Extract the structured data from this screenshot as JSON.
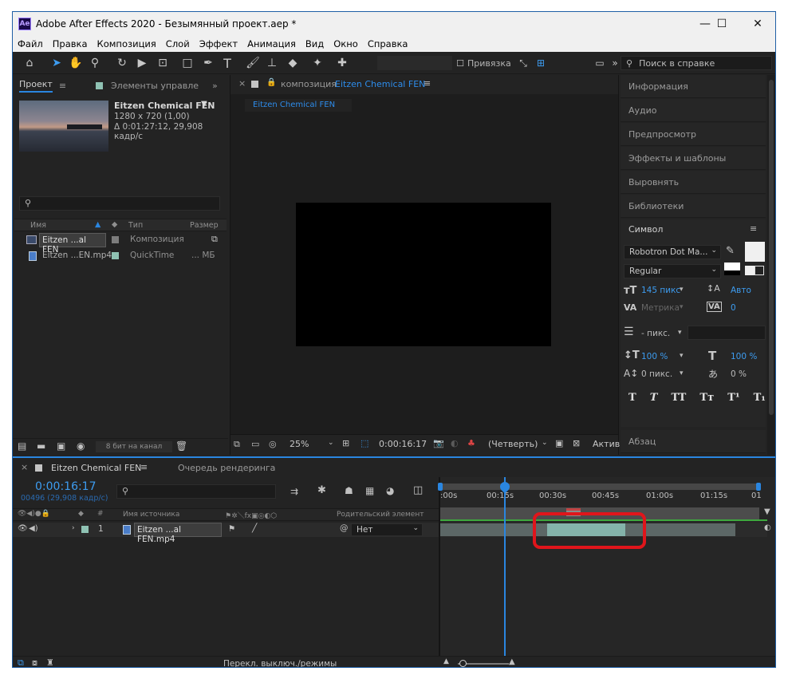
{
  "window": {
    "title": "Adobe After Effects 2020 - Безымянный проект.aep *",
    "app_icon": "Ae",
    "controls": [
      "—",
      "☐",
      "✕"
    ]
  },
  "menu": [
    "Файл",
    "Правка",
    "Композиция",
    "Слой",
    "Эффект",
    "Анимация",
    "Вид",
    "Окно",
    "Справка"
  ],
  "toolbar": {
    "snap_label": "Привязка",
    "help_search_placeholder": "Поиск в справке"
  },
  "project_panel": {
    "tab": "Проект",
    "effects_tab": "Элементы управле",
    "comp_name": "Eitzen Chemical FEN",
    "comp_dims": "1280 x 720 (1,00)",
    "comp_duration": "Δ 0:01:27:12, 29,908 кадр/с",
    "columns": [
      "Имя",
      "Тип",
      "Размер"
    ],
    "items": [
      {
        "name": "Eitzen ...al FEN",
        "type": "Композиция",
        "size": ""
      },
      {
        "name": "Eitzen ...EN.mp4",
        "type": "QuickTime",
        "size": "... МБ"
      }
    ],
    "bit_depth": "8 бит на канал"
  },
  "comp_panel": {
    "tab_label": "композиция",
    "comp_name": "Eitzen Chemical FEN",
    "breadcrumb": "Eitzen Chemical FEN",
    "zoom": "25%",
    "timecode": "0:00:16:17",
    "resolution": "(Четверть)",
    "active_camera": "Актив"
  },
  "right_panels": {
    "items": [
      "Информация",
      "Аудио",
      "Предпросмотр",
      "Эффекты и шаблоны",
      "Выровнять",
      "Библиотеки"
    ],
    "character_title": "Символ",
    "font_name": "Robotron Dot Ma...",
    "font_style": "Regular",
    "font_size": "145 пикс",
    "leading": "Авто",
    "kerning": "Метрика",
    "tracking": "0",
    "line_stroke": "- пикс.",
    "vert_scale": "100 %",
    "horiz_scale": "100 %",
    "baseline": "0 пикс.",
    "tsume": "0 %",
    "style_buttons": [
      "T",
      "T",
      "TT",
      "Tт",
      "T¹",
      "T₁"
    ],
    "paragraph_title": "Абзац"
  },
  "timeline": {
    "tab": "Eitzen Chemical FEN",
    "render_queue_tab": "Очередь рендеринга",
    "timecode": "0:00:16:17",
    "frames": "00496 (29,908 кадр/с)",
    "col_source": "Имя источника",
    "col_parent": "Родительский элемент",
    "layer_number": "1",
    "layer_name": "Eitzen ...al FEN.mp4",
    "parent_value": "Нет",
    "ruler_labels": [
      ":00s",
      "00:15s",
      "00:30s",
      "00:45s",
      "01:00s",
      "01:15s",
      "01"
    ],
    "footer_label": "Перекл. выключ./режимы",
    "highlight_color": "#e0151b",
    "playhead_color": "#2a86e0"
  }
}
